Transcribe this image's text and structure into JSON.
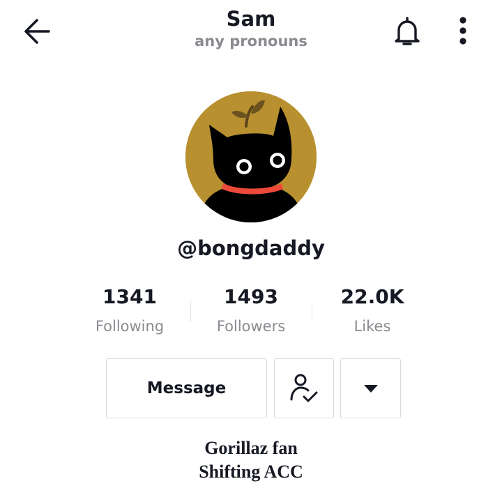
{
  "header": {
    "title": "Sam",
    "subtitle": "any pronouns",
    "back_icon": "arrow-left-icon",
    "bell_icon": "bell-icon",
    "more_icon": "more-vertical-icon"
  },
  "profile": {
    "avatar_icon": "black-cat-with-sprout-avatar",
    "avatar_bg": "#b8902f",
    "username": "@bongdaddy"
  },
  "stats": [
    {
      "value": "1341",
      "label": "Following"
    },
    {
      "value": "1493",
      "label": "Followers"
    },
    {
      "value": "22.0K",
      "label": "Likes"
    }
  ],
  "actions": {
    "message_label": "Message",
    "friend_icon": "person-check-icon",
    "dropdown_icon": "caret-down-icon"
  },
  "bio": {
    "lines": [
      "Gorillaz fan",
      "Shifting ACC"
    ]
  },
  "colors": {
    "text_primary": "#161823",
    "text_secondary": "#8a8b91",
    "border": "#d9d9dc",
    "collar": "#ee4a3c"
  }
}
